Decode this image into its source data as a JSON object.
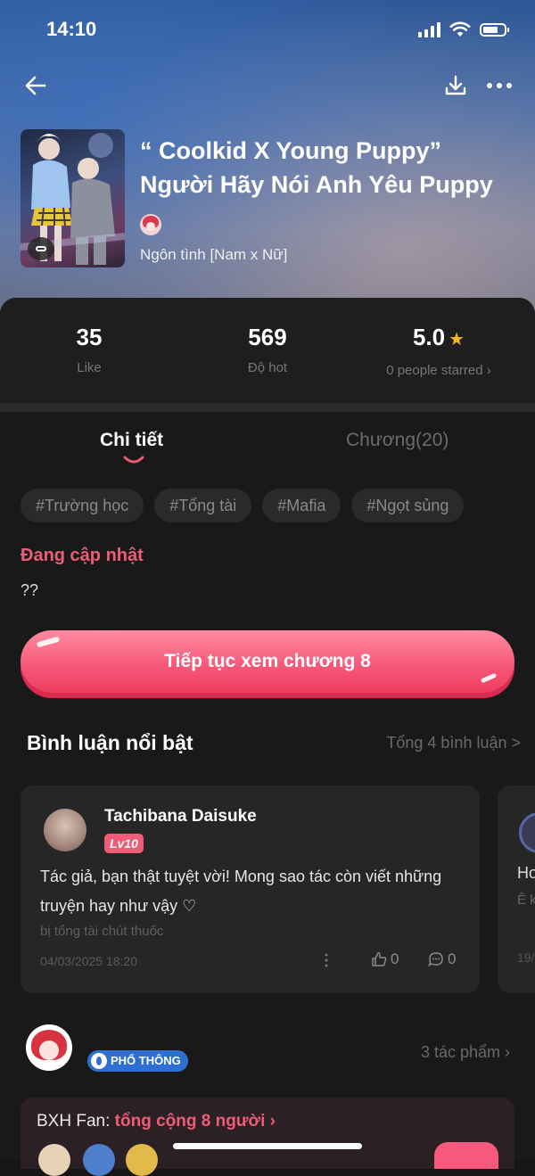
{
  "status_bar": {
    "time": "14:10"
  },
  "book": {
    "title": "“ Coolkid X Young Puppy” Người Hãy Nói Anh Yêu Puppy",
    "genre": "Ngôn tình [Nam x Nữ]"
  },
  "stats": {
    "likes": {
      "value": "35",
      "label": "Like"
    },
    "hot": {
      "value": "569",
      "label": "Độ hot"
    },
    "rating": {
      "value": "5.0",
      "label": "0 people starred ›"
    }
  },
  "tabs": {
    "detail": "Chi tiết",
    "chapters": "Chương(20)"
  },
  "tags": [
    "#Trường học",
    "#Tổng tài",
    "#Mafia",
    "#Ngọt sủng"
  ],
  "status": {
    "label": "Đang cập nhật",
    "text": "??"
  },
  "continue_button": "Tiếp tục xem chương 8",
  "comments": {
    "title": "Bình luận nổi bật",
    "total": "Tổng 4 bình luận >",
    "items": [
      {
        "user": "Tachibana Daisuke",
        "level": "Lv10",
        "text": "Tác giả, bạn thật tuyệt vời! Mong sao tác còn viết những truyện hay như vậy ♡",
        "quote": "bị tổng tài chút thuốc",
        "date": "04/03/2025 18:20",
        "likes": "0",
        "replies": "0"
      }
    ],
    "peek": {
      "text": "Ho",
      "sub": "Ê k",
      "date": "19/"
    }
  },
  "author": {
    "badge": "PHỔ THÔNG",
    "works": "3 tác phẩm ›"
  },
  "fan_rank": {
    "label": "BXH Fan: ",
    "count": "tổng cộng 8 người ›"
  },
  "colors": {
    "accent": "#ef5c77",
    "background": "#191919",
    "card": "#262626",
    "star": "#f6b52a",
    "badge": "#2f6fd1"
  }
}
